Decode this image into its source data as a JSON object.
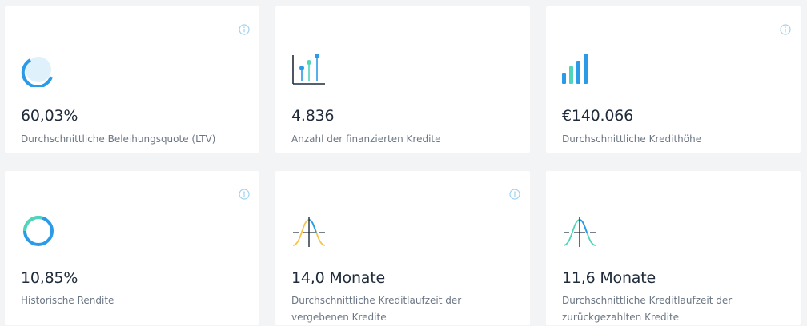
{
  "colors": {
    "background": "#f2f4f6",
    "card": "#ffffff",
    "value_text": "#1f2b3a",
    "label_text": "#6b7684",
    "accent_blue": "#2b9be8",
    "accent_light_blue": "#dff1fb",
    "accent_teal": "#4fd6b9",
    "accent_yellow": "#f7c44b",
    "info_icon": "#9ed2f0"
  },
  "cards": [
    {
      "value": "60,03%",
      "label": "Durchschnittliche Beleihungsquote (LTV)",
      "icon": "ring-gauge-icon",
      "has_info": true
    },
    {
      "value": "4.836",
      "label": "Anzahl der finanzierten Kredite",
      "icon": "lollipop-chart-icon",
      "has_info": false
    },
    {
      "value": "€140.066",
      "label": "Durchschnittliche Kredithöhe",
      "icon": "bar-chart-icon",
      "has_info": true
    },
    {
      "value": "10,85%",
      "label": "Historische Rendite",
      "icon": "donut-chart-icon",
      "has_info": true
    },
    {
      "value": "14,0 Monate",
      "label": "Durchschnittliche Kreditlaufzeit der vergebenen Kredite",
      "icon": "bell-curve-icon",
      "has_info": true
    },
    {
      "value": "11,6 Monate",
      "label": "Durchschnittliche Kreditlaufzeit der zurückgezahlten Kredite",
      "icon": "bell-curve-icon",
      "has_info": false
    }
  ]
}
